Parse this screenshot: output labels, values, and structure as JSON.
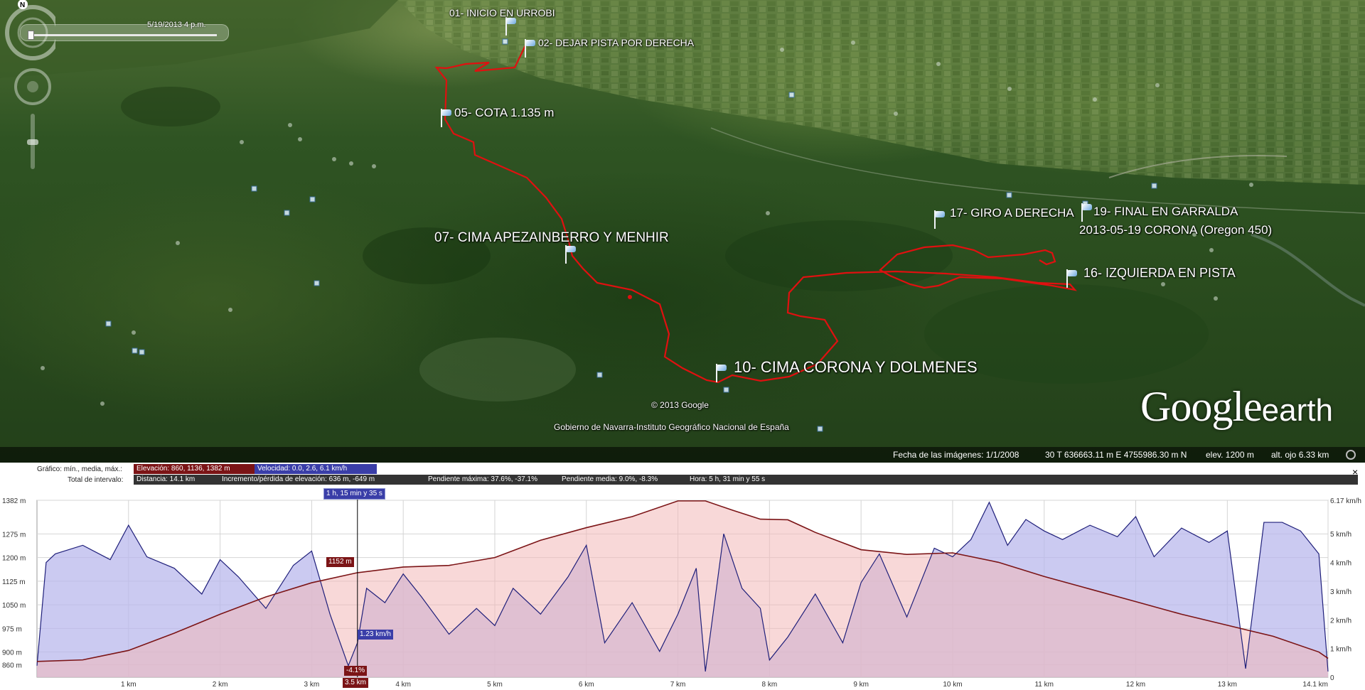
{
  "time_slider": {
    "datetime": "5/19/2013   4 p.m."
  },
  "placemarks": [
    {
      "label": "01- INICIO EN URROBI"
    },
    {
      "label": "02- DEJAR PISTA POR DERECHA"
    },
    {
      "label": "05- COTA 1.135 m"
    },
    {
      "label": "07- CIMA APEZAINBERRO Y MENHIR"
    },
    {
      "label": "10- CIMA CORONA Y DOLMENES"
    },
    {
      "label": "16- IZQUIERDA EN PISTA"
    },
    {
      "label": "17- GIRO A DERECHA"
    },
    {
      "label": "19- FINAL EN GARRALDA"
    }
  ],
  "track_name": "2013-05-19 CORONA (Oregon 450)",
  "copyright": "© 2013 Google",
  "attribution": "Gobierno de Navarra-Instituto Geográfico Nacional de España",
  "logo": {
    "google": "Google",
    "earth": "earth"
  },
  "statusbar": {
    "imagery_date": "Fecha de las imágenes: 1/1/2008",
    "coords": "30 T 636663.11 m E 4755986.30 m N",
    "elev": "elev.  1200 m",
    "eye_alt": "alt. ojo    6.33 km"
  },
  "profile": {
    "graph_label": "Gráfico: mín., media, máx.:",
    "elevation_stat": "Elevación: 860, 1136, 1382 m",
    "speed_stat": "Velocidad: 0.0, 2.6, 6.1 km/h",
    "interval_label": "Total de intervalo:",
    "distance": "Distancia: 14.1 km",
    "gain_loss": "Incremento/pérdida de elevación: 636 m, -649 m",
    "max_slope": "Pendiente máxima: 37.6%, -37.1%",
    "avg_slope": "Pendiente media: 9.0%, -8.3%",
    "time": "Hora: 5 h, 31 min y 55 s",
    "cursor_time": "1 h, 15 min y 35 s",
    "cursor_elev": "1152 m",
    "cursor_speed": "1.23 km/h",
    "cursor_slope": "-4.1%",
    "cursor_dist": "3.5 km",
    "close": "×"
  },
  "chart_data": {
    "type": "line",
    "x_unit": "km",
    "xlim": [
      0,
      14.1
    ],
    "x_ticks": [
      "1 km",
      "2 km",
      "3 km",
      "4 km",
      "5 km",
      "6 km",
      "7 km",
      "8 km",
      "9 km",
      "10 km",
      "11 km",
      "12 km",
      "13 km",
      "14.1 km"
    ],
    "x_tick_values": [
      1,
      2,
      3,
      4,
      5,
      6,
      7,
      8,
      9,
      10,
      11,
      12,
      13,
      14.1
    ],
    "y_left_ticks": [
      "1382 m",
      "1275 m",
      "1200 m",
      "1125 m",
      "1050 m",
      "975 m",
      "900 m",
      "860 m"
    ],
    "y_left_values": [
      1382,
      1275,
      1200,
      1125,
      1050,
      975,
      900,
      860
    ],
    "ylim_left": [
      820,
      1382
    ],
    "y_right_ticks": [
      "6.17 km/h",
      "5 km/h",
      "4 km/h",
      "3 km/h",
      "2 km/h",
      "1 km/h",
      "0"
    ],
    "y_right_values": [
      6.17,
      5,
      4,
      3,
      2,
      1,
      0
    ],
    "ylim_right": [
      0,
      6.17
    ],
    "grid": true,
    "cursor_x": 3.5,
    "series": [
      {
        "key": "elevation",
        "color": "#7b1416",
        "x": [
          0,
          0.5,
          1,
          1.5,
          2,
          2.5,
          3,
          3.5,
          4,
          4.5,
          5,
          5.5,
          6,
          6.5,
          7,
          7.3,
          7.6,
          7.9,
          8.2,
          8.5,
          9,
          9.5,
          10,
          10.5,
          11,
          11.5,
          12,
          12.5,
          13,
          13.5,
          14,
          14.1
        ],
        "y": [
          870,
          875,
          905,
          960,
          1020,
          1075,
          1120,
          1152,
          1170,
          1175,
          1200,
          1255,
          1295,
          1330,
          1380,
          1380,
          1350,
          1322,
          1320,
          1280,
          1225,
          1210,
          1215,
          1185,
          1140,
          1100,
          1060,
          1020,
          985,
          950,
          900,
          880
        ]
      },
      {
        "key": "speed",
        "color": "#1f1f7a",
        "x": [
          0,
          0.1,
          0.2,
          0.5,
          0.8,
          1,
          1.2,
          1.5,
          1.8,
          2,
          2.2,
          2.5,
          2.8,
          3,
          3.2,
          3.4,
          3.5,
          3.6,
          3.8,
          4,
          4.2,
          4.5,
          4.8,
          5,
          5.2,
          5.5,
          5.8,
          6,
          6.2,
          6.5,
          6.8,
          7,
          7.2,
          7.3,
          7.5,
          7.7,
          7.9,
          8,
          8.2,
          8.5,
          8.8,
          9,
          9.2,
          9.5,
          9.8,
          10,
          10.2,
          10.4,
          10.6,
          10.8,
          11,
          11.2,
          11.5,
          11.8,
          12,
          12.2,
          12.5,
          12.8,
          13,
          13.2,
          13.4,
          13.6,
          13.8,
          14,
          14.1
        ],
        "y": [
          0.4,
          4,
          4.3,
          4.6,
          4.1,
          5.3,
          4.2,
          3.8,
          2.9,
          4.1,
          3.5,
          2.4,
          3.9,
          4.4,
          2.2,
          0.4,
          1.2,
          3.1,
          2.6,
          3.6,
          2.8,
          1.5,
          2.4,
          1.8,
          3.1,
          2.2,
          3.5,
          4.6,
          1.2,
          2.6,
          0.9,
          2.2,
          3.8,
          0.2,
          5,
          3.1,
          2.4,
          0.6,
          1.4,
          2.9,
          1.2,
          3.3,
          4.3,
          2.1,
          4.5,
          4.2,
          4.8,
          6.1,
          4.6,
          5.5,
          5.1,
          4.8,
          5.3,
          4.9,
          5.6,
          4.2,
          5.2,
          4.7,
          5.1,
          0.3,
          5.4,
          5.4,
          5.1,
          4.3,
          0.2
        ]
      }
    ]
  }
}
